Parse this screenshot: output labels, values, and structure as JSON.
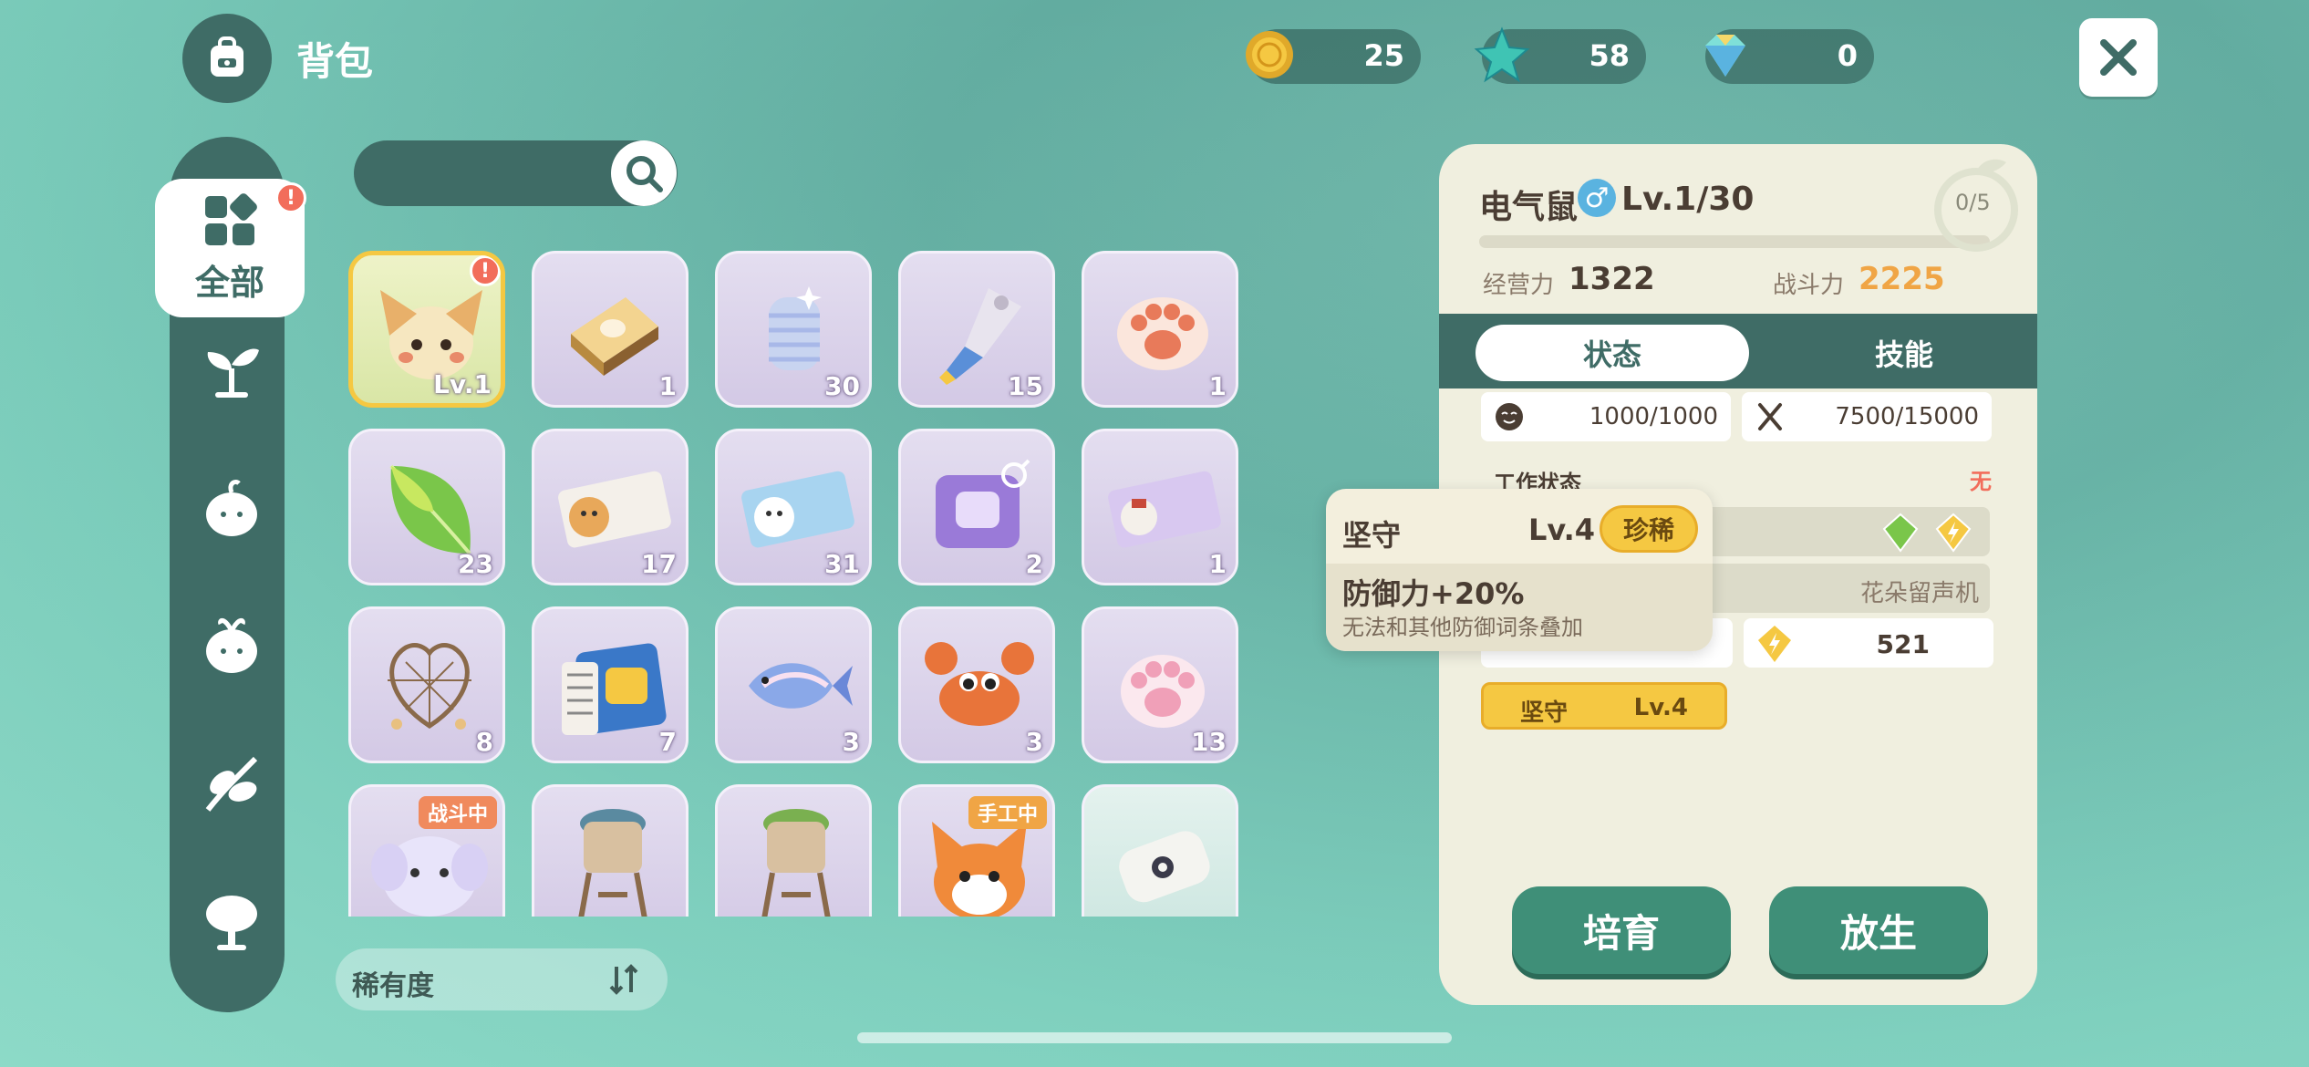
{
  "header": {
    "title": "背包"
  },
  "currencies": [
    {
      "name": "coin-icon",
      "value": "25"
    },
    {
      "name": "star-icon",
      "value": "58"
    },
    {
      "name": "gem-icon",
      "value": "0"
    }
  ],
  "sidebar": {
    "all_label": "全部",
    "all_alert": "!"
  },
  "search": {
    "placeholder": ""
  },
  "items": [
    {
      "icon": "mouse-pet-icon",
      "count": "Lv.1",
      "alert": "!"
    },
    {
      "icon": "bread-box-icon",
      "count": "1"
    },
    {
      "icon": "yarn-roll-icon",
      "count": "30"
    },
    {
      "icon": "paint-tube-icon",
      "count": "15"
    },
    {
      "icon": "paw-cushion-icon",
      "count": "1"
    },
    {
      "icon": "leaf-icon",
      "count": "23"
    },
    {
      "icon": "ticket-icon",
      "count": "17"
    },
    {
      "icon": "ticket-blue-icon",
      "count": "31"
    },
    {
      "icon": "purple-ticket-icon",
      "count": "2"
    },
    {
      "icon": "ticket-purple-icon",
      "count": "1"
    },
    {
      "icon": "dreamcatcher-icon",
      "count": "8"
    },
    {
      "icon": "film-card-icon",
      "count": "7"
    },
    {
      "icon": "fish-icon",
      "count": "3"
    },
    {
      "icon": "crab-icon",
      "count": "3"
    },
    {
      "icon": "pink-paw-icon",
      "count": "13"
    },
    {
      "icon": "elephant-pet-icon",
      "count": "",
      "tag": "战斗中"
    },
    {
      "icon": "water-tower-icon",
      "count": ""
    },
    {
      "icon": "water-tower-green-icon",
      "count": ""
    },
    {
      "icon": "fox-pet-icon",
      "count": "",
      "tag": "手工中"
    },
    {
      "icon": "scroll-icon",
      "count": ""
    }
  ],
  "sort": {
    "label": "稀有度"
  },
  "detail": {
    "name": "电气鼠",
    "gender": "♂",
    "level": "Lv.1/30",
    "fruit_value": "0/5",
    "xp_fraction": 0.0,
    "stats": {
      "work_label": "经营力",
      "work_value": "1322",
      "fight_label": "战斗力",
      "fight_value": "2225"
    },
    "tabs": {
      "active": "状态",
      "other": "技能"
    },
    "mood": "1000/1000",
    "food": "7500/15000",
    "work_state_label": "工作状态",
    "work_state_value": "无",
    "work_place": "花朵留声机",
    "power_value": "521",
    "passive": {
      "name": "坚守",
      "level": "Lv.4"
    },
    "buttons": {
      "train": "培育",
      "release": "放生"
    }
  },
  "tooltip": {
    "name": "坚守",
    "level": "Lv.4",
    "rarity": "珍稀",
    "effect": "防御力+20%",
    "desc": "无法和其他防御词条叠加"
  }
}
